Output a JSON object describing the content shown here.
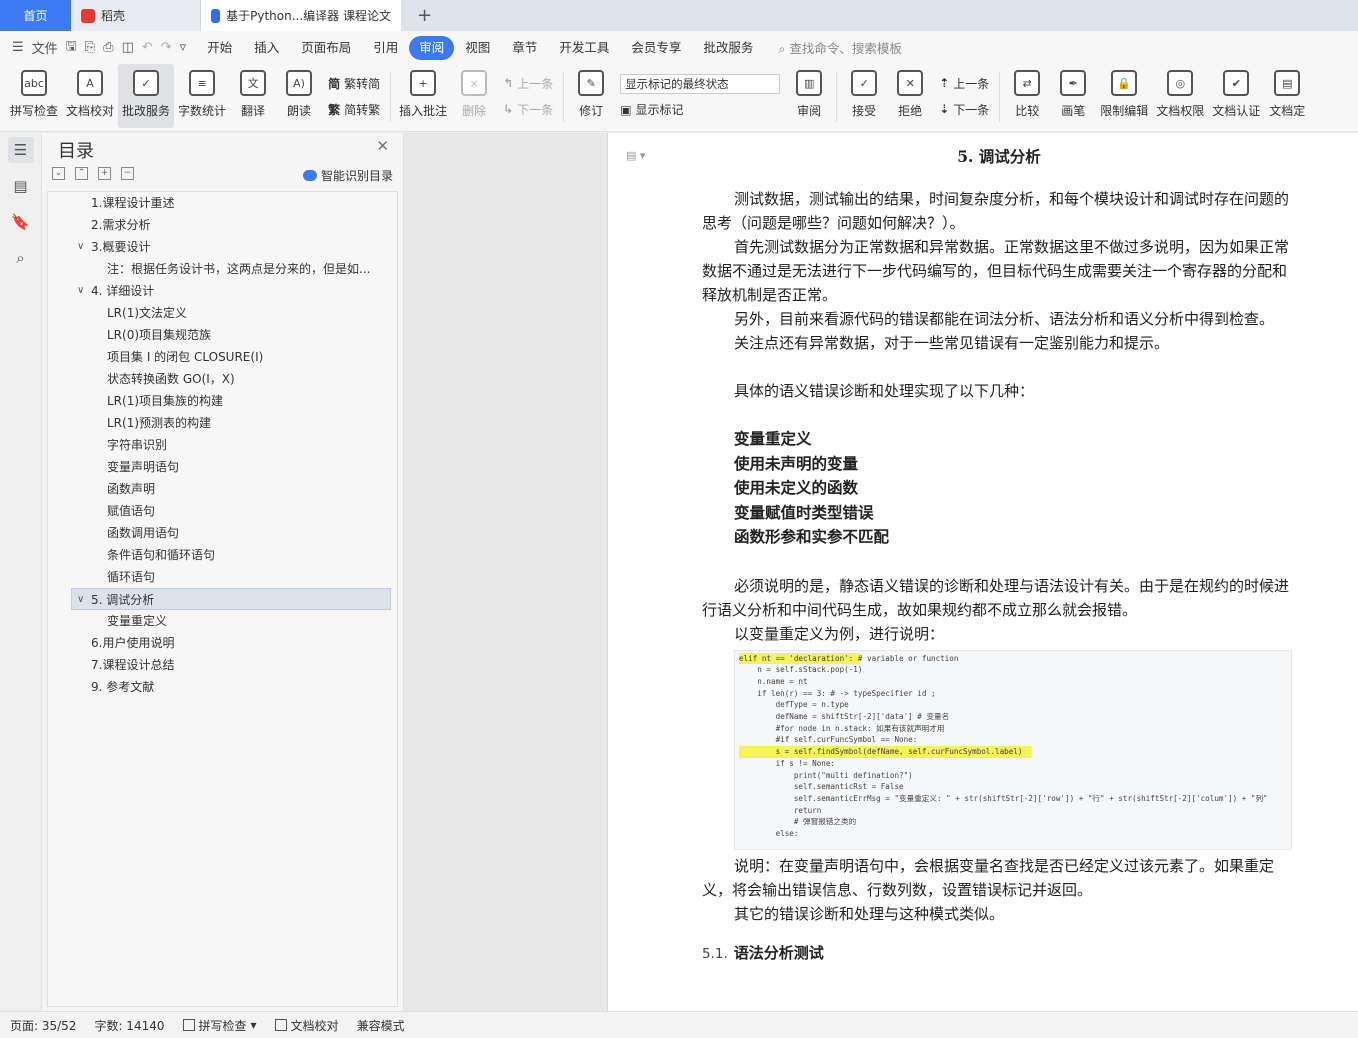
{
  "tabs": {
    "home": "首页",
    "daoke": "稻壳",
    "doc": "基于Python...编译器 课程论文"
  },
  "menu": {
    "file": "文件",
    "items": [
      "开始",
      "插入",
      "页面布局",
      "引用",
      "审阅",
      "视图",
      "章节",
      "开发工具",
      "会员专享",
      "批改服务"
    ],
    "active": "审阅",
    "search": "查找命令、搜索模板"
  },
  "ribbon": {
    "spellcheck": "拼写检查",
    "proof": "文档校对",
    "correct": "批改服务",
    "wordcount": "字数统计",
    "translate": "翻译",
    "read": "朗读",
    "trad": "繁转简",
    "simp": "简转繁",
    "insert_comment": "插入批注",
    "delete": "删除",
    "prev": "上一条",
    "next": "下一条",
    "revise": "修订",
    "markup_select": "显示标记的最终状态",
    "show_markup": "显示标记",
    "review": "审阅",
    "accept": "接受",
    "reject": "拒绝",
    "prev2": "上一条",
    "next2": "下一条",
    "compare": "比较",
    "pen": "画笔",
    "restrict": "限制编辑",
    "rights": "文档权限",
    "certify": "文档认证",
    "finalize": "文档定"
  },
  "toc": {
    "title": "目录",
    "smart": "智能识别目录",
    "items": [
      {
        "text": "1.课程设计重述",
        "level": 1
      },
      {
        "text": "2.需求分析",
        "level": 1
      },
      {
        "text": "3.概要设计",
        "level": 1,
        "caret": true
      },
      {
        "text": "注：根据任务设计书，这两点是分来的，但是如...",
        "level": 2
      },
      {
        "text": "4. 详细设计",
        "level": 1,
        "caret": true
      },
      {
        "text": "LR(1)文法定义",
        "level": 2
      },
      {
        "text": "LR(0)项目集规范族",
        "level": 2
      },
      {
        "text": "项目集 I 的闭包 CLOSURE(I)",
        "level": 2
      },
      {
        "text": "状态转换函数 GO(I，X)",
        "level": 2
      },
      {
        "text": "LR(1)项目集族的构建",
        "level": 2
      },
      {
        "text": "LR(1)预测表的构建",
        "level": 2
      },
      {
        "text": "字符串识别",
        "level": 2
      },
      {
        "text": "变量声明语句",
        "level": 2
      },
      {
        "text": "函数声明",
        "level": 2
      },
      {
        "text": "赋值语句",
        "level": 2
      },
      {
        "text": "函数调用语句",
        "level": 2
      },
      {
        "text": "条件语句和循环语句",
        "level": 2
      },
      {
        "text": "循环语句",
        "level": 2
      },
      {
        "text": "5. 调试分析",
        "level": 1,
        "caret": true,
        "selected": true
      },
      {
        "text": "变量重定义",
        "level": 2
      },
      {
        "text": "6.用户使用说明",
        "level": 1
      },
      {
        "text": "7.课程设计总结",
        "level": 1
      },
      {
        "text": "9. 参考文献",
        "level": 1
      }
    ]
  },
  "doc": {
    "heading": "5.   调试分析",
    "p1": "测试数据，测试输出的结果，时间复杂度分析，和每个模块设计和调试时存在问题的思考（问题是哪些？问题如何解决？）。",
    "p2": "首先测试数据分为正常数据和异常数据。正常数据这里不做过多说明，因为如果正常数据不通过是无法进行下一步代码编写的，但目标代码生成需要关注一个寄存器的分配和释放机制是否正常。",
    "p3": "另外，目前来看源代码的错误都能在词法分析、语法分析和语义分析中得到检查。",
    "p4": "关注点还有异常数据，对于一些常见错误有一定鉴别能力和提示。",
    "p5": "具体的语义错误诊断和处理实现了以下几种：",
    "errors": [
      "变量重定义",
      "使用未声明的变量",
      "使用未定义的函数",
      "变量赋值时类型错误",
      "函数形参和实参不匹配"
    ],
    "p6": "必须说明的是，静态语义错误的诊断和处理与语法设计有关。由于是在规约的时候进行语义分析和中间代码生成，故如果规约都不成立那么就会报错。",
    "p7": "以变量重定义为例，进行说明：",
    "p8": "说明：在变量声明语句中，会根据变量名查找是否已经定义过该元素了。如果重定义，将会输出错误信息、行数列数，设置错误标记并返回。",
    "p9": "其它的错误诊断和处理与这种模式类似。",
    "h51_num": "5.1.",
    "h51": "语法分析测试"
  },
  "code": {
    "lines": [
      "elif nt == 'declaration': # variable or function",
      "    n = self.sStack.pop(-1)",
      "    n.name = nt",
      "",
      "    if len(r) == 3: # -> typeSpecifier id ;",
      "        defType = n.type",
      "        defName = shiftStr[-2]['data'] # 变量名",
      "        #for node in n.stack: 如果有该就声明才用",
      "        #if self.curFuncSymbol == None:",
      "        s = self.findSymbol(defName, self.curFuncSymbol.label)",
      "        if s != None:",
      "            print(\"multi defination?\")",
      "            self.semanticRst = False",
      "            self.semanticErrMsg = \"变量重定义: \" + str(shiftStr[-2]['row']) + \"行\" + str(shiftStr[-2]['colum']) + \"列\"",
      "            return",
      "            # 弹窗报错之类的",
      "        else:"
    ]
  },
  "status": {
    "page": "页面: 35/52",
    "words": "字数: 14140",
    "spell": "拼写检查",
    "proof": "文档校对",
    "compat": "兼容模式"
  }
}
